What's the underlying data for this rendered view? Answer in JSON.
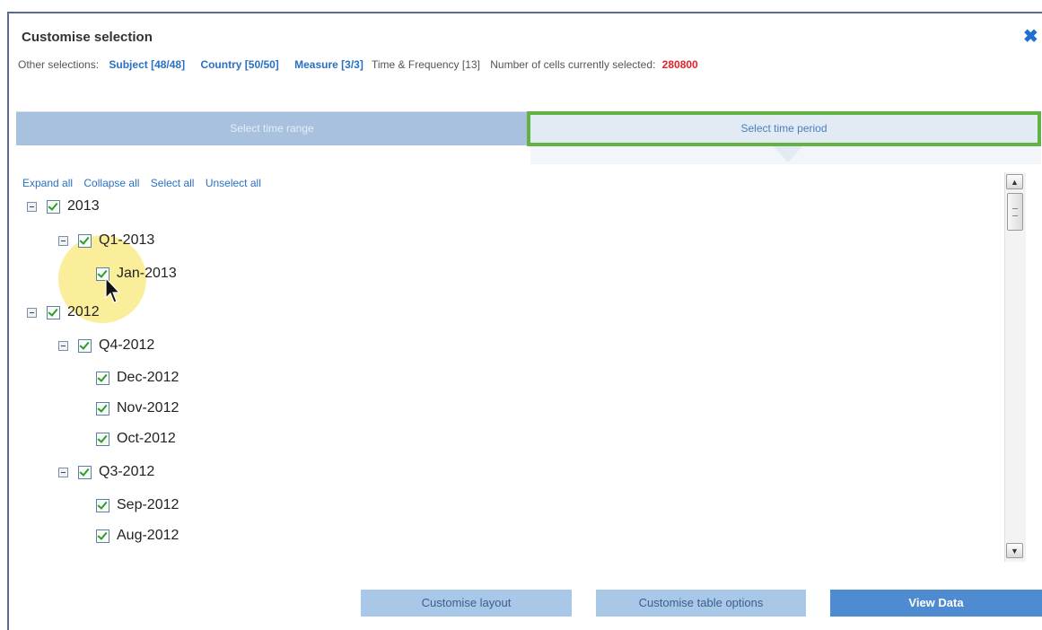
{
  "dialog": {
    "title": "Customise selection"
  },
  "other_selections": {
    "label": "Other selections:",
    "subject": "Subject [48/48]",
    "country": "Country [50/50]",
    "measure": "Measure [3/3]",
    "time": "Time & Frequency [13]",
    "cells_label": "Number of cells currently selected:",
    "cells_count": "280800"
  },
  "tabs": {
    "time_range": "Select time range",
    "time_period": "Select time period"
  },
  "actions": {
    "expand": "Expand all",
    "collapse": "Collapse all",
    "select": "Select all",
    "unselect": "Unselect all"
  },
  "tree": {
    "y2013": "2013",
    "q1_2013": "Q1-2013",
    "jan_2013": "Jan-2013",
    "y2012": "2012",
    "q4_2012": "Q4-2012",
    "dec_2012": "Dec-2012",
    "nov_2012": "Nov-2012",
    "oct_2012": "Oct-2012",
    "q3_2012": "Q3-2012",
    "sep_2012": "Sep-2012",
    "aug_2012": "Aug-2012"
  },
  "buttons": {
    "layout": "Customise layout",
    "table_options": "Customise table options",
    "view": "View Data"
  },
  "colors": {
    "accent": "#2a6fc2",
    "active_tab_border": "#63b344",
    "count": "#e0222b",
    "primary_button": "#4e8bd0"
  }
}
